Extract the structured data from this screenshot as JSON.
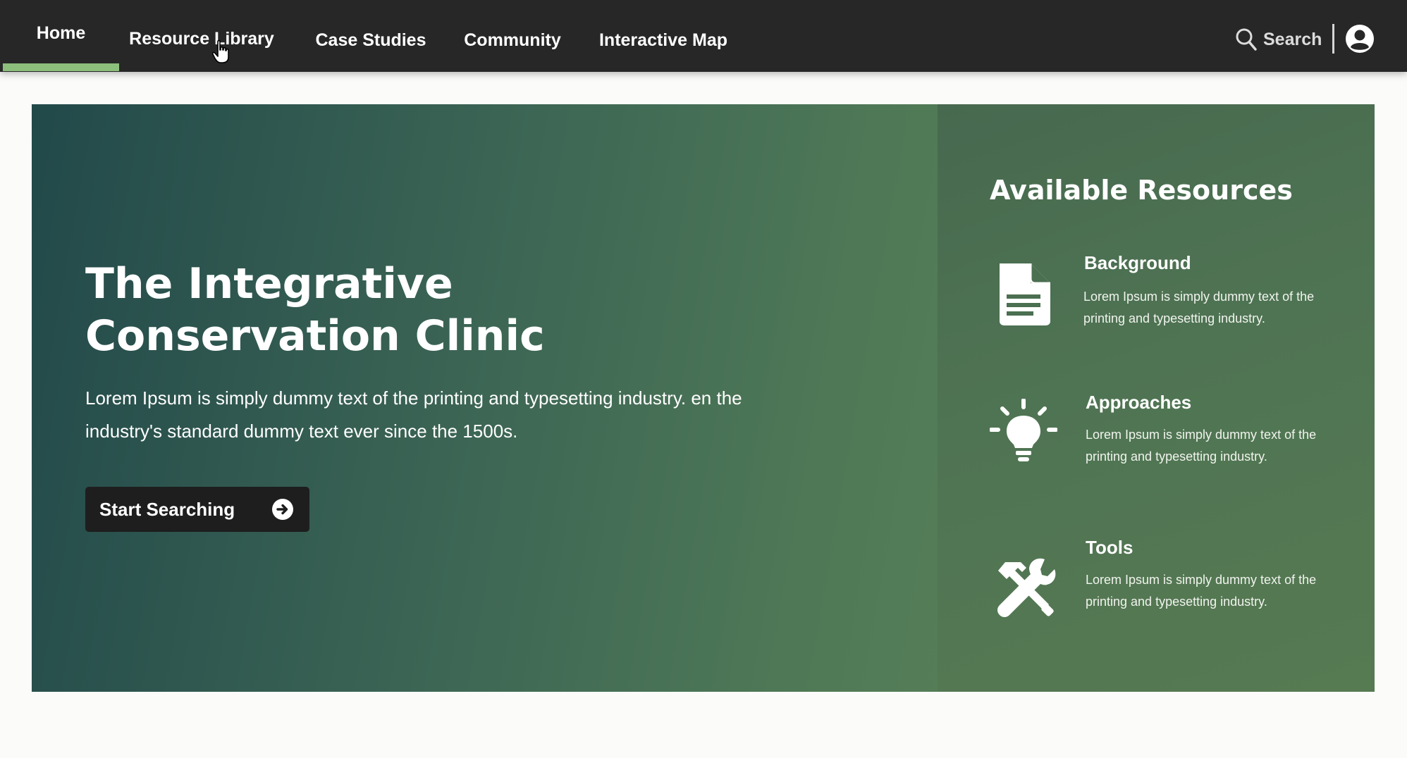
{
  "nav": {
    "items": [
      {
        "label": "Home"
      },
      {
        "label": "Resource Library"
      },
      {
        "label": "Case Studies"
      },
      {
        "label": "Community"
      },
      {
        "label": "Interactive Map"
      }
    ],
    "active": "Home",
    "search_label": "Search",
    "accent_color": "#8dbf7c"
  },
  "hero": {
    "title_line1": "The Integrative",
    "title_line2": "Conservation Clinic",
    "description": "Lorem Ipsum is simply dummy text of the printing and typesetting industry. en the industry's standard dummy text ever since the 1500s.",
    "cta_label": "Start Searching"
  },
  "resources": {
    "heading": "Available Resources",
    "items": [
      {
        "title": "Background",
        "text": "Lorem Ipsum is simply dummy text of the printing and typesetting industry.",
        "icon": "document-icon"
      },
      {
        "title": "Approaches",
        "text": "Lorem Ipsum is simply dummy text of the printing and typesetting industry.",
        "icon": "lightbulb-icon"
      },
      {
        "title": "Tools",
        "text": "Lorem Ipsum is simply dummy text of the printing and typesetting industry.",
        "icon": "tools-icon"
      }
    ]
  }
}
